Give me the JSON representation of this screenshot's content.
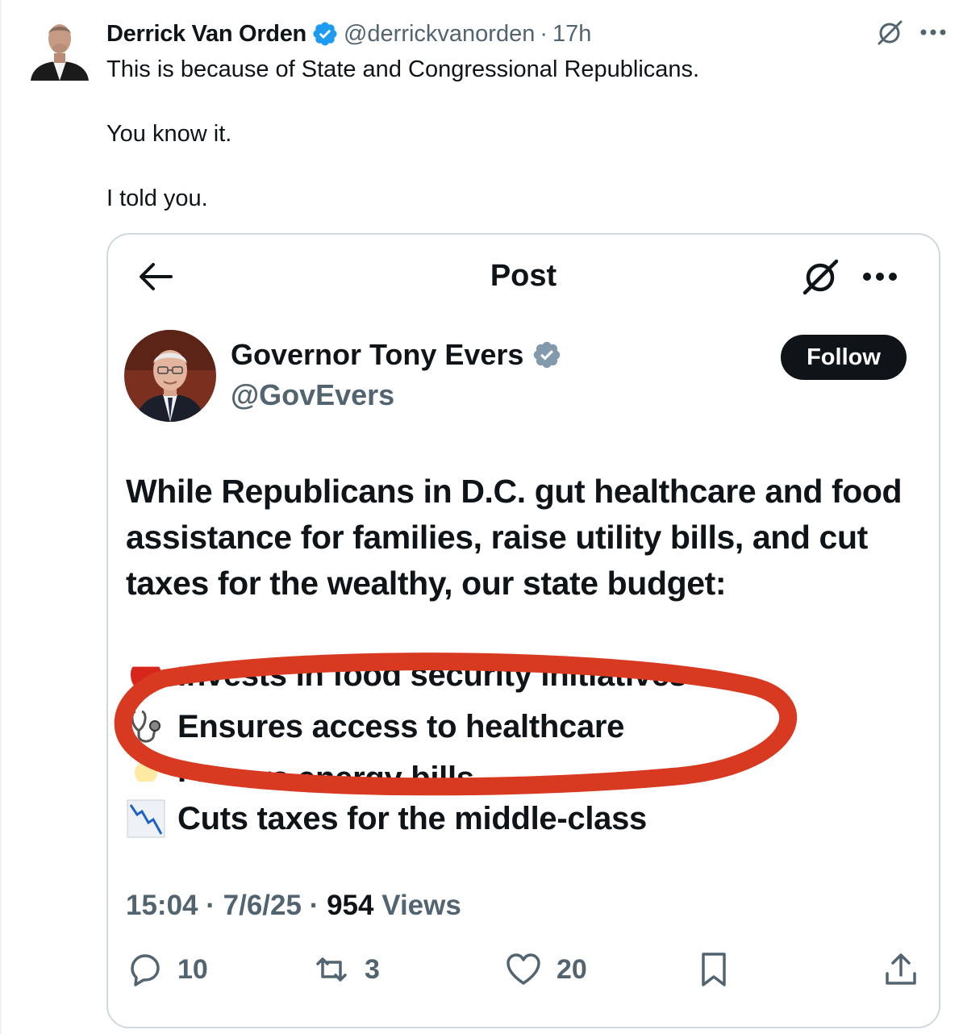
{
  "tweet": {
    "author_name": "Derrick Van Orden",
    "handle": "@derrickvanorden",
    "separator": "·",
    "time": "17h",
    "lines": [
      "This is because of State and Congressional Republicans.",
      "You know it.",
      "I told you."
    ]
  },
  "card": {
    "title": "Post",
    "follow_label": "Follow",
    "author_name": "Governor Tony Evers",
    "handle": "@GovEvers",
    "text": "While Republicans in D.C. gut healthcare and food assistance for families, raise utility bills, and cut taxes for the wealthy, our state budget:",
    "list": [
      {
        "icon": "apple-icon",
        "text": "Invests in food security initiatives"
      },
      {
        "icon": "stethoscope-icon",
        "text": "Ensures access to healthcare"
      },
      {
        "icon": "lightbulb-icon",
        "text": "Lowers energy bills"
      },
      {
        "icon": "chart-decreasing-icon",
        "text": "Cuts taxes for the middle-class"
      }
    ],
    "meta": {
      "time": "15:04",
      "sep1": "·",
      "date": "7/6/25",
      "sep2": "·",
      "views": "954",
      "views_label": "Views"
    },
    "stats": {
      "replies": "10",
      "reposts": "3",
      "likes": "20"
    },
    "highlight_color": "#d83a21"
  },
  "colors": {
    "verified": "#1d9bf0",
    "verified_gov": "#829aab",
    "text": "#0f1419",
    "secondary": "#536471"
  }
}
